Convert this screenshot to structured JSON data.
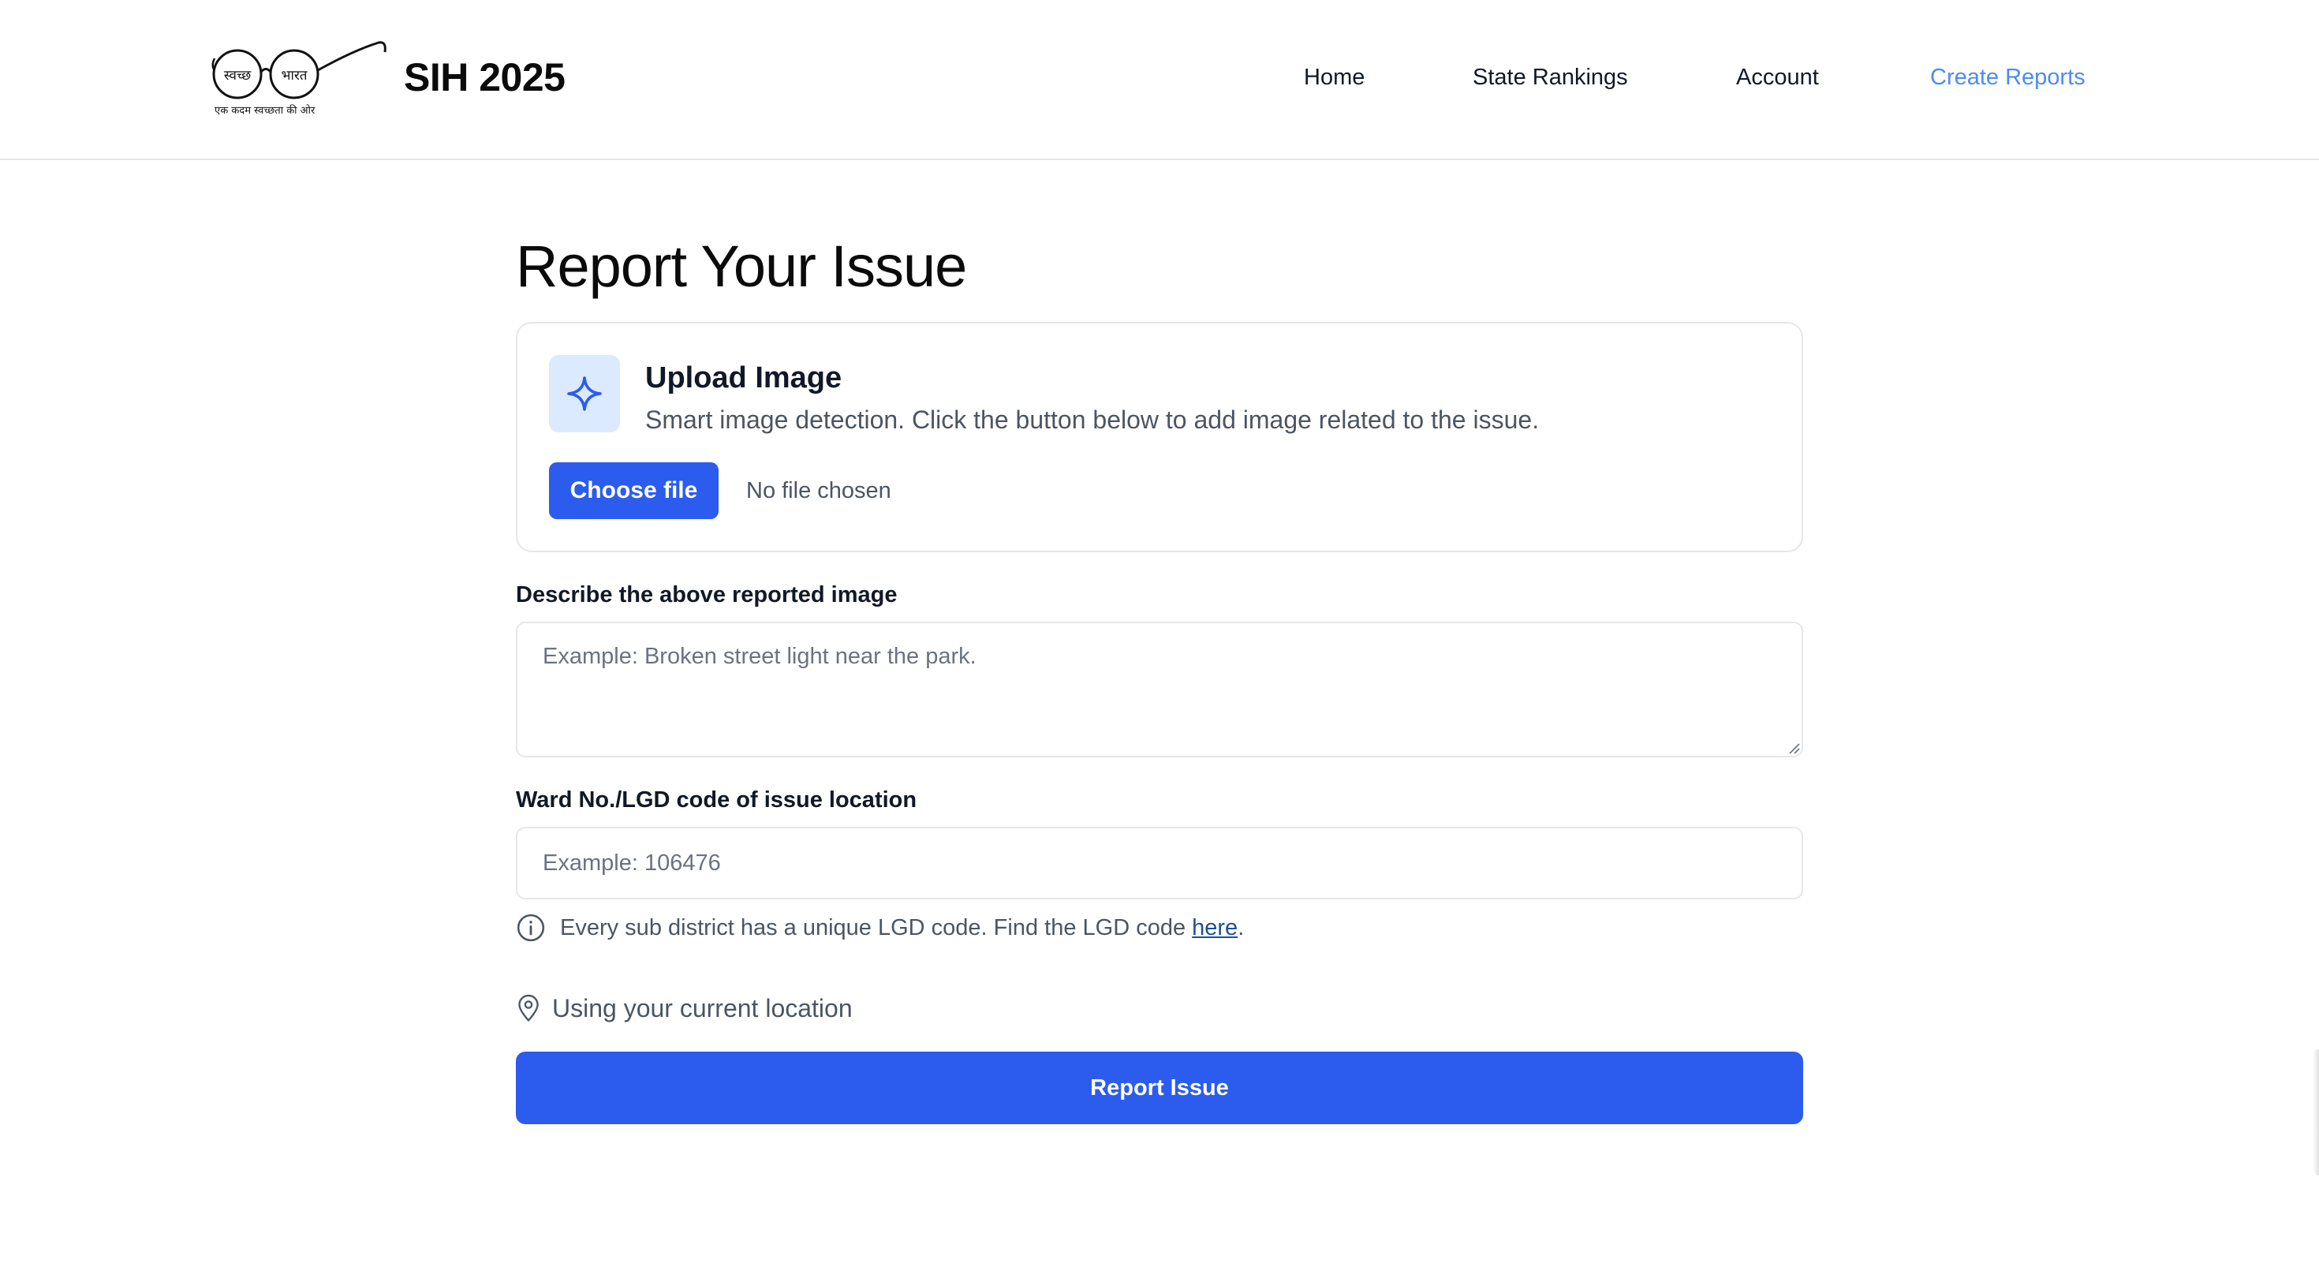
{
  "header": {
    "logo_text_left": "स्वच्छ",
    "logo_text_right": "भारत",
    "logo_tagline": "एक कदम स्वच्छता की ओर",
    "brand": "SIH 2025",
    "nav": [
      {
        "label": "Home",
        "active": false
      },
      {
        "label": "State Rankings",
        "active": false
      },
      {
        "label": "Account",
        "active": false
      },
      {
        "label": "Create Reports",
        "active": true
      }
    ],
    "active_color": "#4c8bf5"
  },
  "main": {
    "title": "Report Your Issue",
    "upload": {
      "icon": "sparkle-icon",
      "title": "Upload Image",
      "description": "Smart image detection. Click the button below to add image related to the issue.",
      "button_label": "Choose file",
      "file_status": "No file chosen"
    },
    "description_field": {
      "label": "Describe the above reported image",
      "placeholder": "Example: Broken street light near the park.",
      "value": ""
    },
    "ward_field": {
      "label": "Ward No./LGD code of issue location",
      "placeholder": "Example: 106476",
      "value": ""
    },
    "hint": {
      "icon": "info-icon",
      "text": "Every sub district has a unique LGD code. Find the LGD code ",
      "link_text": "here",
      "suffix": "."
    },
    "location": {
      "icon": "map-pin-icon",
      "text": "Using your current location"
    },
    "submit_label": "Report Issue",
    "primary_color": "#2b5cee"
  }
}
